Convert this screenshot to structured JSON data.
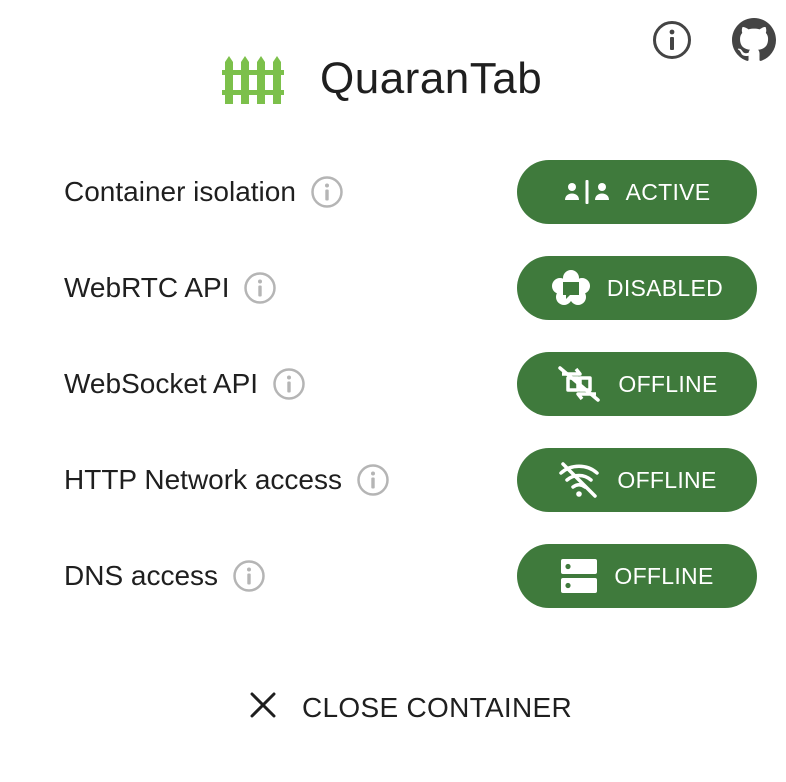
{
  "app": {
    "title": "QuaranTab"
  },
  "header_icons": [
    {
      "icon": "info-circle-icon"
    },
    {
      "icon": "github-icon"
    }
  ],
  "settings": [
    {
      "label": "Container isolation",
      "status": "ACTIVE",
      "icon": "user-separator-icon"
    },
    {
      "label": "WebRTC API",
      "status": "DISABLED",
      "icon": "webrtc-icon"
    },
    {
      "label": "WebSocket API",
      "status": "OFFLINE",
      "icon": "socket-off-icon"
    },
    {
      "label": "HTTP Network access",
      "status": "OFFLINE",
      "icon": "wifi-off-icon"
    },
    {
      "label": "DNS access",
      "status": "OFFLINE",
      "icon": "server-icon"
    }
  ],
  "footer": {
    "close_label": "CLOSE CONTAINER"
  },
  "colors": {
    "accent": "#3f7a3c",
    "logo_green": "#7cc04b",
    "info_gray": "#b5b5b5"
  }
}
